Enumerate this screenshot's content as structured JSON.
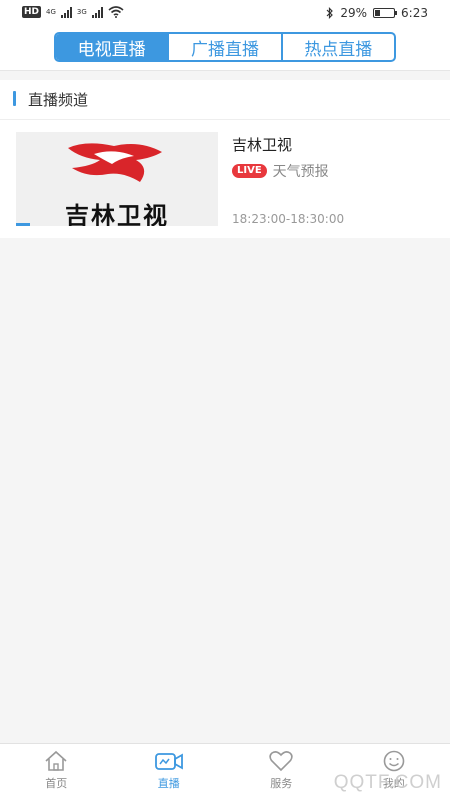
{
  "status_bar": {
    "hd": "HD",
    "net_1": "4G",
    "net_2": "3G",
    "battery_percent": "29%",
    "time": "6:23",
    "battery_level": 0.29
  },
  "top_tabs": [
    {
      "label": "电视直播",
      "active": true
    },
    {
      "label": "广播直播",
      "active": false
    },
    {
      "label": "热点直播",
      "active": false
    }
  ],
  "section": {
    "title": "直播频道"
  },
  "channel": {
    "name": "吉林卫视",
    "thumbnail_text": "吉林卫视",
    "live_badge": "LIVE",
    "program": "天气预报",
    "time_range": "18:23:00-18:30:00"
  },
  "bottom_nav": [
    {
      "label": "首页",
      "icon": "home-icon",
      "active": false
    },
    {
      "label": "直播",
      "icon": "video-camera-icon",
      "active": true
    },
    {
      "label": "服务",
      "icon": "heart-icon",
      "active": false
    },
    {
      "label": "我的",
      "icon": "smiley-icon",
      "active": false
    }
  ],
  "watermark": "QQTF.COM",
  "colors": {
    "accent": "#3d98e0",
    "live": "#e8383d"
  }
}
